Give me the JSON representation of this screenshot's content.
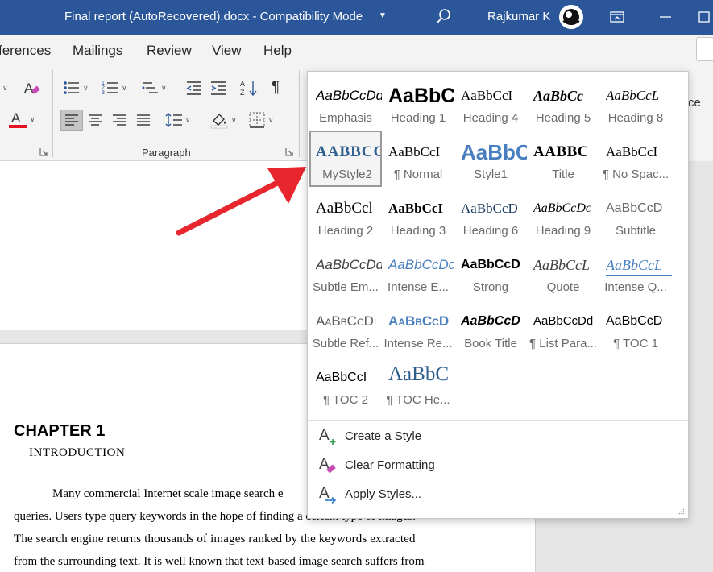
{
  "titlebar": {
    "title": "Final report (AutoRecovered).docx  -  Compatibility Mode",
    "user": "Rajkumar K",
    "accent": "#2b579a"
  },
  "tabs": [
    "ferences",
    "Mailings",
    "Review",
    "View",
    "Help"
  ],
  "ribbon": {
    "group_label": "Paragraph",
    "font_color": "#e81123"
  },
  "right_pane": {
    "text": "ce"
  },
  "document": {
    "chapter": "CHAPTER 1",
    "introduction": "INTRODUCTION",
    "lines": [
      "Many commercial Internet scale image search e",
      "queries. Users type query keywords in the hope of finding a certain type of images.",
      "The search engine returns thousands of images ranked by the keywords extracted",
      "from the surrounding text. It is well known that text-based image search suffers from"
    ]
  },
  "gallery": {
    "styles": [
      {
        "name": "Emphasis",
        "preview": "AaBbCcDd"
      },
      {
        "name": "Heading 1",
        "preview": "AaBbC"
      },
      {
        "name": "Heading 4",
        "preview": "AaBbCcI"
      },
      {
        "name": "Heading 5",
        "preview": "AaBbCc"
      },
      {
        "name": "Heading 8",
        "preview": "AaBbCcL"
      },
      {
        "name": "MyStyle2",
        "preview": "AABBCC"
      },
      {
        "name": "¶ Normal",
        "preview": "AaBbCcI"
      },
      {
        "name": "Style1",
        "preview": "AaBbC"
      },
      {
        "name": "Title",
        "preview": "AABBC"
      },
      {
        "name": "¶ No Spac...",
        "preview": "AaBbCcI"
      },
      {
        "name": "Heading 2",
        "preview": "AaBbCcl"
      },
      {
        "name": "Heading 3",
        "preview": "AaBbCcI"
      },
      {
        "name": "Heading 6",
        "preview": "AaBbCcD"
      },
      {
        "name": "Heading 9",
        "preview": "AaBbCcDc"
      },
      {
        "name": "Subtitle",
        "preview": "AaBbCcD"
      },
      {
        "name": "Subtle Em...",
        "preview": "AaBbCcDd"
      },
      {
        "name": "Intense E...",
        "preview": "AaBbCcDd"
      },
      {
        "name": "Strong",
        "preview": "AaBbCcD"
      },
      {
        "name": "Quote",
        "preview": "AaBbCcL"
      },
      {
        "name": "Intense Q...",
        "preview": "AaBbCcL"
      },
      {
        "name": "Subtle Ref...",
        "preview": "AaBbCcDi"
      },
      {
        "name": "Intense Re...",
        "preview": "AaBbCcD"
      },
      {
        "name": "Book Title",
        "preview": "AaBbCcD"
      },
      {
        "name": "¶ List Para...",
        "preview": "AaBbCcDd"
      },
      {
        "name": "¶ TOC 1",
        "preview": "AaBbCcD"
      },
      {
        "name": "¶ TOC 2",
        "preview": "AaBbCcI"
      },
      {
        "name": "¶ TOC He...",
        "preview": "AaBbC"
      }
    ],
    "selected": "MyStyle2",
    "commands": [
      {
        "label": "Create a Style",
        "icon": "create-style-icon"
      },
      {
        "label": "Clear Formatting",
        "icon": "clear-formatting-icon"
      },
      {
        "label": "Apply Styles...",
        "icon": "apply-styles-icon"
      }
    ]
  },
  "annotation": {
    "arrow_color": "#e8262d"
  }
}
